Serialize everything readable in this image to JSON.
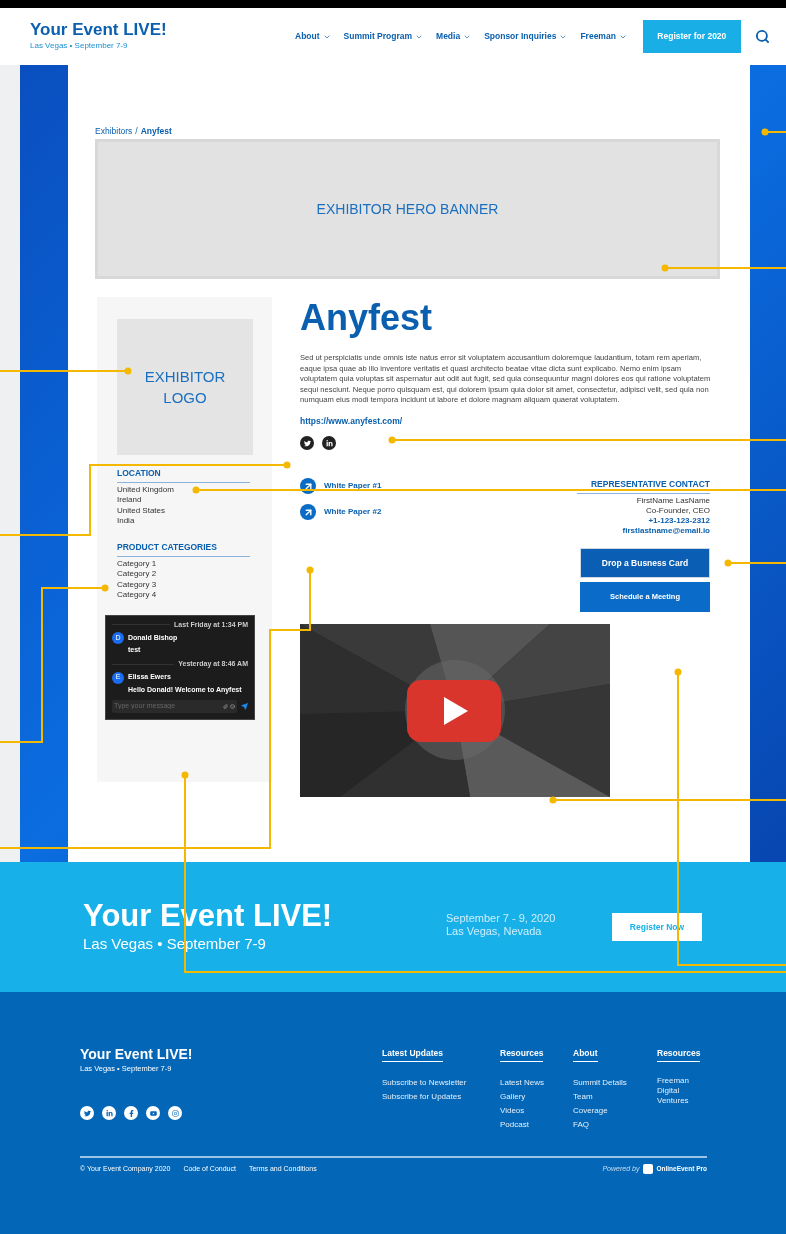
{
  "header": {
    "title": "Your Event LIVE!",
    "subtitle": "Las Vegas • September 7-9",
    "nav": [
      {
        "label": "About"
      },
      {
        "label": "Summit Program"
      },
      {
        "label": "Media"
      },
      {
        "label": "Sponsor Inquiries"
      },
      {
        "label": "Freeman"
      }
    ],
    "register_button": "Register for 2020"
  },
  "breadcrumb_separator": "/",
  "breadcrumb": [
    {
      "label": "Exhibitors",
      "current": false
    },
    {
      "label": "Anyfest",
      "current": true
    }
  ],
  "hero_banner": "EXHIBITOR HERO BANNER",
  "sidebar": {
    "logo": "EXHIBITOR LOGO",
    "sections": [
      {
        "title": "LOCATION",
        "items": [
          "United Kingdom",
          "Ireland",
          "United States",
          "India"
        ]
      },
      {
        "title": "PRODUCT CATEGORIES",
        "items": [
          "Category 1",
          "Category 2",
          "Category 3",
          "Category 4"
        ]
      }
    ],
    "chat": {
      "messages": [
        {
          "time": "Last Friday at 1:34 PM",
          "avatar": "D",
          "name": "Donald Bishop",
          "text": "test"
        },
        {
          "time": "Yesterday at 8:46 AM",
          "avatar": "E",
          "name": "Elissa Ewers",
          "text": "Hello Donald! Welcome to Anyfest"
        }
      ],
      "placeholder": "Type your message"
    }
  },
  "exhibitor": {
    "name": "Anyfest",
    "description": "Sed ut perspiciatis unde omnis iste natus error sit voluptatem accusantium doloremque laudantium, totam rem aperiam, eaque ipsa quae ab illo inventore veritatis et quasi architecto beatae vitae dicta sunt explicabo. Nemo enim ipsam voluptatem quia voluptas sit aspernatur aut odit aut fugit, sed quia consequuntur magni dolores eos qui ratione voluptatem sequi nesciunt. Neque porro quisquam est, qui dolorem ipsum quia dolor sit amet, consectetur, adipisci velit, sed quia non numquam eius modi tempora incidunt ut labore et dolore magnam aliquam quaerat voluptatem.",
    "url": "https://www.anyfest.com/"
  },
  "documents": [
    "White Paper #1",
    "White Paper #2"
  ],
  "contact": {
    "title": "REPRESENTATIVE CONTACT",
    "name": "FirstName LasName",
    "role": "Co-Founder, CEO",
    "phone": "+1-123-123-2312",
    "email": "firstlastname@email.io"
  },
  "actions": [
    "Drop a Busness Card",
    "Schedule a Meeting"
  ],
  "band": {
    "title": "Your Event LIVE!",
    "subtitle": "Las Vegas • September 7-9",
    "date": "September 7 - 9, 2020",
    "place": "Las Vegas, Nevada",
    "button": "Register Now"
  },
  "footer": {
    "title": "Your Event LIVE!",
    "subtitle": "Las Vegas • September 7-9",
    "columns": [
      {
        "heading": "Latest Updates",
        "links": [
          "Subscribe to Newsletter",
          "Subscribe for Updates"
        ]
      },
      {
        "heading": "Resources",
        "links": [
          "Latest News",
          "Gallery",
          "Videos",
          "Podcast"
        ]
      },
      {
        "heading": "About",
        "links": [
          "Summit Details",
          "Team",
          "Coverage",
          "FAQ"
        ]
      },
      {
        "heading": "Resources",
        "links": [
          "Freeman Digital Ventures"
        ]
      }
    ],
    "bottom_links": [
      "© Your Event Company 2020",
      "Code of Conduct",
      "Terms and Conditions"
    ],
    "powered_by": "Powered by",
    "brand": "OnlineEvent Pro"
  }
}
